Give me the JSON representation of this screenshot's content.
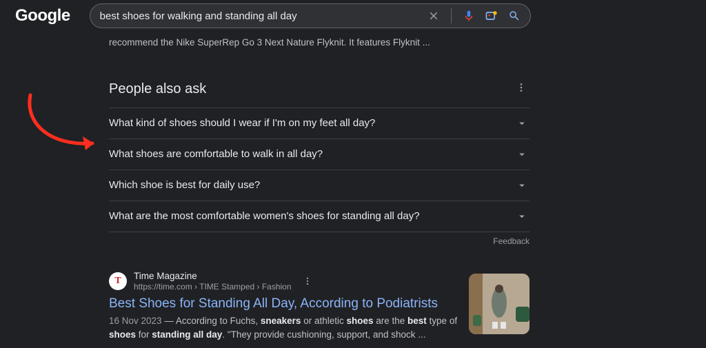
{
  "search": {
    "logo": "Google",
    "query": "best shoes for walking and standing all day"
  },
  "top_fragment": {
    "line1": "recommend the Nike SuperRep Go 3 Next Nature Flyknit. It features Flyknit ..."
  },
  "paa": {
    "heading": "People also ask",
    "items": [
      "What kind of shoes should I wear if I'm on my feet all day?",
      "What shoes are comfortable to walk in all day?",
      "Which shoe is best for daily use?",
      "What are the most comfortable women's shoes for standing all day?"
    ],
    "feedback": "Feedback"
  },
  "result": {
    "favicon_letter": "T",
    "source_name": "Time Magazine",
    "source_path": "https://time.com › TIME Stamped › Fashion",
    "title": "Best Shoes for Standing All Day, According to Podiatrists",
    "date": "16 Nov 2023",
    "snippet_pre": " — According to Fuchs, ",
    "bold1": "sneakers",
    "mid1": " or athletic ",
    "bold2": "shoes",
    "mid2": " are the ",
    "bold3": "best",
    "mid3": " type of ",
    "bold4": "shoes",
    "mid4": " for ",
    "bold5": "standing all day",
    "tail": ". \"They provide cushioning, support, and shock ..."
  }
}
